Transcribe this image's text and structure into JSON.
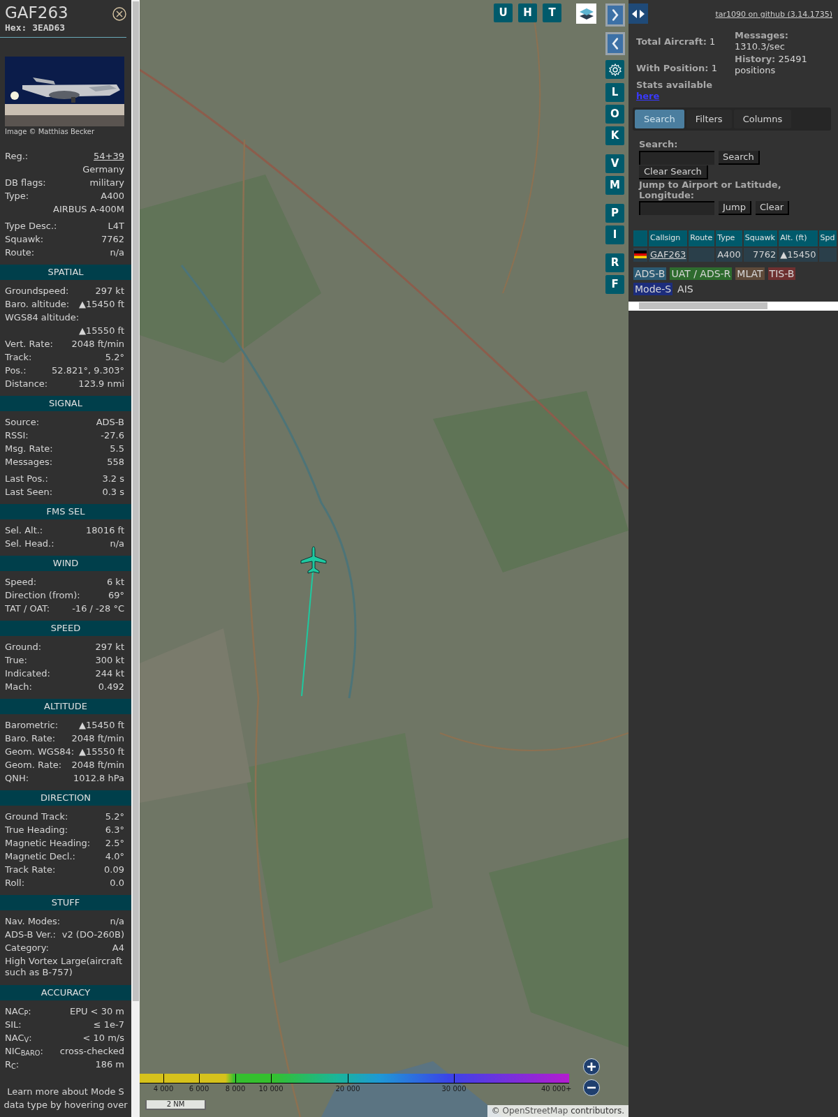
{
  "aircraft": {
    "callsign": "GAF263",
    "hex": "Hex: 3EAD63"
  },
  "photo": {
    "kind": "picture",
    "caption": "Image © Matthias Becker"
  },
  "sections": [
    {
      "groups": [
        [
          {
            "kind": "link",
            "label": "Reg.:",
            "value": "54+39"
          },
          {
            "kind": "value",
            "value": "Germany"
          },
          {
            "kind": "pair",
            "label": "DB flags:",
            "value": "military"
          },
          {
            "kind": "pair",
            "label": "Type:",
            "value": "A400"
          },
          {
            "kind": "value",
            "value": "AIRBUS A-400M"
          }
        ],
        [
          {
            "kind": "pair",
            "label": "Type Desc.:",
            "value": "L4T"
          },
          {
            "kind": "pair",
            "label": "Squawk:",
            "value": "7762"
          },
          {
            "kind": "pair",
            "label": "Route:",
            "value": "n/a"
          }
        ]
      ]
    },
    {
      "title": "SPATIAL",
      "groups": [
        [
          {
            "kind": "pair",
            "label": "Groundspeed:",
            "value": "297 kt"
          },
          {
            "kind": "pair",
            "label": "Baro. altitude:",
            "value": "▲15450 ft"
          },
          {
            "kind": "label",
            "label": "WGS84 altitude:"
          },
          {
            "kind": "value",
            "value": "▲15550 ft"
          },
          {
            "kind": "pair",
            "label": "Vert. Rate:",
            "value": "2048 ft/min"
          },
          {
            "kind": "pair",
            "label": "Track:",
            "value": "5.2°"
          },
          {
            "kind": "pair",
            "label": "Pos.:",
            "value": "52.821°, 9.303°"
          },
          {
            "kind": "pair",
            "label": "Distance:",
            "value": "123.9 nmi"
          }
        ]
      ]
    },
    {
      "title": "SIGNAL",
      "groups": [
        [
          {
            "kind": "pair",
            "label": "Source:",
            "value": "ADS-B"
          },
          {
            "kind": "pair",
            "label": "RSSI:",
            "value": "-27.6"
          },
          {
            "kind": "pair",
            "label": "Msg. Rate:",
            "value": "5.5"
          },
          {
            "kind": "pair",
            "label": "Messages:",
            "value": "558"
          }
        ],
        [
          {
            "kind": "pair",
            "label": "Last Pos.:",
            "value": "3.2 s"
          },
          {
            "kind": "pair",
            "label": "Last Seen:",
            "value": "0.3 s"
          }
        ]
      ]
    },
    {
      "title": "FMS SEL",
      "groups": [
        [
          {
            "kind": "pair",
            "label": "Sel. Alt.:",
            "value": "18016 ft"
          },
          {
            "kind": "pair",
            "label": "Sel. Head.:",
            "value": "n/a"
          }
        ]
      ]
    },
    {
      "title": "WIND",
      "groups": [
        [
          {
            "kind": "pair",
            "label": "Speed:",
            "value": "6 kt"
          },
          {
            "kind": "pair",
            "label": "Direction (from):",
            "value": "69°"
          },
          {
            "kind": "pair",
            "label": "TAT / OAT:",
            "value": "-16 / -28 °C"
          }
        ]
      ]
    },
    {
      "title": "SPEED",
      "groups": [
        [
          {
            "kind": "pair",
            "label": "Ground:",
            "value": "297 kt"
          },
          {
            "kind": "pair",
            "label": "True:",
            "value": "300 kt"
          },
          {
            "kind": "pair",
            "label": "Indicated:",
            "value": "244 kt"
          },
          {
            "kind": "pair",
            "label": "Mach:",
            "value": "0.492"
          }
        ]
      ]
    },
    {
      "title": "ALTITUDE",
      "groups": [
        [
          {
            "kind": "pair",
            "label": "Barometric:",
            "value": "▲15450 ft"
          },
          {
            "kind": "pair",
            "label": "Baro. Rate:",
            "value": "2048 ft/min"
          },
          {
            "kind": "pair",
            "label": "Geom. WGS84:",
            "value": "▲15550 ft"
          },
          {
            "kind": "pair",
            "label": "Geom. Rate:",
            "value": "2048 ft/min"
          },
          {
            "kind": "pair",
            "label": "QNH:",
            "value": "1012.8 hPa"
          }
        ]
      ]
    },
    {
      "title": "DIRECTION",
      "groups": [
        [
          {
            "kind": "pair",
            "label": "Ground Track:",
            "value": "5.2°"
          },
          {
            "kind": "pair",
            "label": "True Heading:",
            "value": "6.3°"
          },
          {
            "kind": "pair",
            "label": "Magnetic Heading:",
            "value": "2.5°"
          },
          {
            "kind": "pair",
            "label": "Magnetic Decl.:",
            "value": "4.0°"
          },
          {
            "kind": "pair",
            "label": "Track Rate:",
            "value": "0.09"
          },
          {
            "kind": "pair",
            "label": "Roll:",
            "value": "0.0"
          }
        ]
      ]
    },
    {
      "title": "STUFF",
      "groups": [
        [
          {
            "kind": "pair",
            "label": "Nav. Modes:",
            "value": "n/a"
          },
          {
            "kind": "pair",
            "label": "ADS-B Ver.:",
            "value": "v2 (DO-260B)"
          },
          {
            "kind": "pair",
            "label": "Category:",
            "value": "A4"
          },
          {
            "kind": "note",
            "value": "High Vortex Large(aircraft such as B-757)"
          }
        ]
      ]
    },
    {
      "title": "ACCURACY",
      "groups": [
        [
          {
            "kind": "pair",
            "label": "NAC$_{P}$:",
            "value": "EPU < 30 m"
          },
          {
            "kind": "pair",
            "label": "SIL:",
            "value": "≤ 1e-7"
          },
          {
            "kind": "pair",
            "label": "NAC$_{V}$:",
            "value": "< 10 m/s"
          },
          {
            "kind": "pair",
            "label": "NIC$_{BARO}$:",
            "value": "cross-checked"
          },
          {
            "kind": "pair",
            "label": "R$_{C}$:",
            "value": "186 m"
          }
        ]
      ]
    }
  ],
  "footer_note": "Learn more about Mode S data type by hovering over",
  "map": {
    "kind": "picture",
    "top_buttons": [
      "U",
      "H",
      "T"
    ],
    "side_buttons": [
      [
        "L",
        "O",
        "K"
      ],
      [
        "V",
        "M"
      ],
      [
        "P",
        "I"
      ],
      [
        "R",
        "F"
      ]
    ],
    "legend_ticks": [
      "4 000",
      "6 000",
      "8 000",
      "10 000",
      "20 000",
      "30 000",
      "40 000+"
    ],
    "scale": "2 NM",
    "attribution": {
      "prefix": "©",
      "link": "OpenStreetMap",
      "suffix": "contributors."
    }
  },
  "right_panel": {
    "github_link": "tar1090 on github (3.14.1735)",
    "stats": [
      {
        "label": "Total Aircraft:",
        "value": "1"
      },
      {
        "label": "With Position:",
        "value": "1"
      }
    ],
    "messages": {
      "label": "Messages:",
      "value": "1310.3/sec"
    },
    "history": {
      "label": "History:",
      "value": "25491 positions"
    },
    "stats_text": "Stats available",
    "stats_link": "here",
    "tabs": [
      {
        "label": "Search",
        "selected": true
      },
      {
        "label": "Filters",
        "selected": false
      },
      {
        "label": "Columns",
        "selected": false
      }
    ],
    "search": {
      "label": "Search:",
      "button": "Search",
      "clear_button": "Clear Search"
    },
    "jump": {
      "label": "Jump to Airport or Latitude, Longitude:",
      "button": "Jump",
      "clear_button": "Clear"
    },
    "table": {
      "columns": [
        "Callsign",
        "Route",
        "Type",
        "Squawk",
        "Alt. (ft)",
        "Spd"
      ],
      "rows": [
        {
          "callsign": "GAF263",
          "type": "A400",
          "squawk": "7762",
          "altitude": "▲15450"
        }
      ]
    },
    "legend": [
      {
        "label": "ADS-B",
        "color": "#2b5a73"
      },
      {
        "label": "UAT / ADS-R",
        "color": "#2e6b2e"
      },
      {
        "label": "MLAT",
        "color": "#5e4a3a"
      },
      {
        "label": "TIS-B",
        "color": "#6e3030"
      },
      {
        "label": "Mode-S",
        "color": "#1d2d7c"
      },
      {
        "label": "AIS"
      }
    ]
  }
}
